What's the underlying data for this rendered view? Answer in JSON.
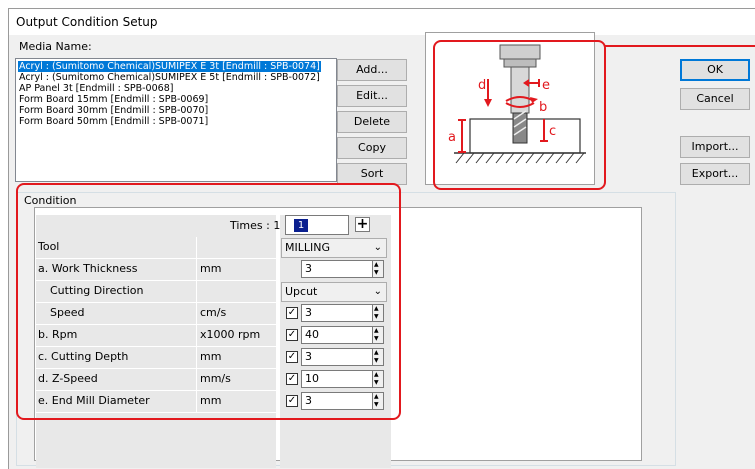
{
  "window": {
    "title": "Output Condition Setup"
  },
  "media": {
    "label": "Media Name:",
    "items": [
      {
        "text": "Acryl : (Sumitomo Chemical)SUMIPEX E 3t [Endmill : SPB-0074]",
        "selected": true
      },
      {
        "text": "Acryl : (Sumitomo Chemical)SUMIPEX E 5t [Endmill : SPB-0072]",
        "selected": false
      },
      {
        "text": "AP Panel 3t [Endmill : SPB-0068]",
        "selected": false
      },
      {
        "text": "Form Board 15mm [Endmill : SPB-0069]",
        "selected": false
      },
      {
        "text": "Form Board 30mm [Endmill : SPB-0070]",
        "selected": false
      },
      {
        "text": "Form Board 50mm [Endmill : SPB-0071]",
        "selected": false
      }
    ]
  },
  "buttons": {
    "add": "Add...",
    "edit": "Edit...",
    "delete": "Delete",
    "copy": "Copy",
    "sort": "Sort",
    "ok": "OK",
    "cancel": "Cancel",
    "import": "Import...",
    "export": "Export..."
  },
  "diagram": {
    "labels": {
      "a": "a",
      "b": "b",
      "c": "c",
      "d": "d",
      "e": "e"
    }
  },
  "condition": {
    "label": "Condition",
    "times_label": "Times : 1",
    "times_value": "1",
    "add_icon": "plus-icon",
    "rows": [
      {
        "name": "Tool",
        "unit": "",
        "type": "dropdown",
        "value": "MILLING"
      },
      {
        "name": "a. Work Thickness",
        "unit": "mm",
        "type": "spin",
        "value": "3",
        "check": false
      },
      {
        "name": "Cutting Direction",
        "unit": "",
        "type": "dropdown",
        "value": "Upcut"
      },
      {
        "name": "Speed",
        "unit": "cm/s",
        "type": "spin",
        "value": "3",
        "check": true
      },
      {
        "name": "b. Rpm",
        "unit": "x1000 rpm",
        "type": "spin",
        "value": "40",
        "check": true
      },
      {
        "name": "c. Cutting Depth",
        "unit": "mm",
        "type": "spin",
        "value": "3",
        "check": true
      },
      {
        "name": "d. Z-Speed",
        "unit": "mm/s",
        "type": "spin",
        "value": "10",
        "check": true
      },
      {
        "name": "e. End Mill Diameter",
        "unit": "mm",
        "type": "spin",
        "value": "3",
        "check": true
      }
    ]
  },
  "colors": {
    "highlight": "#e2191e",
    "selection": "#0078d7"
  }
}
